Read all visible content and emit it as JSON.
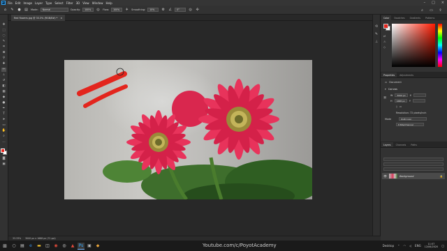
{
  "menubar": {
    "logo": "Ps",
    "items": [
      "File",
      "Edit",
      "Image",
      "Layer",
      "Type",
      "Select",
      "Filter",
      "3D",
      "View",
      "Window",
      "Help"
    ]
  },
  "options": {
    "mode_label": "Mode:",
    "mode_value": "Normal",
    "opacity_label": "Opacity:",
    "opacity_value": "100%",
    "flow_label": "Flow:",
    "flow_value": "100%",
    "smoothing_label": "Smoothing:",
    "smoothing_value": "10%",
    "angle_value": "0°"
  },
  "document": {
    "tab_title": "Red flowers.jpg @ 33.3% (RGB/8#) *",
    "status_zoom": "33.33%",
    "status_info": "3000 px x 1688 px (72 ppi)"
  },
  "color_panel": {
    "tabs": [
      "Color",
      "Swatches",
      "Gradients",
      "Patterns"
    ],
    "fg_color": "#e3251d",
    "bg_color": "#ffffff"
  },
  "properties_panel": {
    "tabs": [
      "Properties",
      "Adjustments"
    ],
    "doc_label": "Document",
    "canvas_title": "Canvas",
    "width_label": "W",
    "width_value": "3000 px",
    "height_label": "H",
    "height_value": "1688 px",
    "x_label": "X",
    "y_label": "Y",
    "resolution_label": "Resolution: 72 pixels/inch",
    "mode_label": "Mode",
    "mode_value": "RGB Color",
    "depth_value": "8 Bits/Channel"
  },
  "layers_panel": {
    "tabs": [
      "Layers",
      "Channels",
      "Paths"
    ],
    "layer_name": "Background"
  },
  "taskbar": {
    "watermark": "Youtube.com/c/PoyotAcademy",
    "desktop_label": "Desktop",
    "lang": "ENG",
    "time": "11:57",
    "date": "12/06/2020"
  }
}
